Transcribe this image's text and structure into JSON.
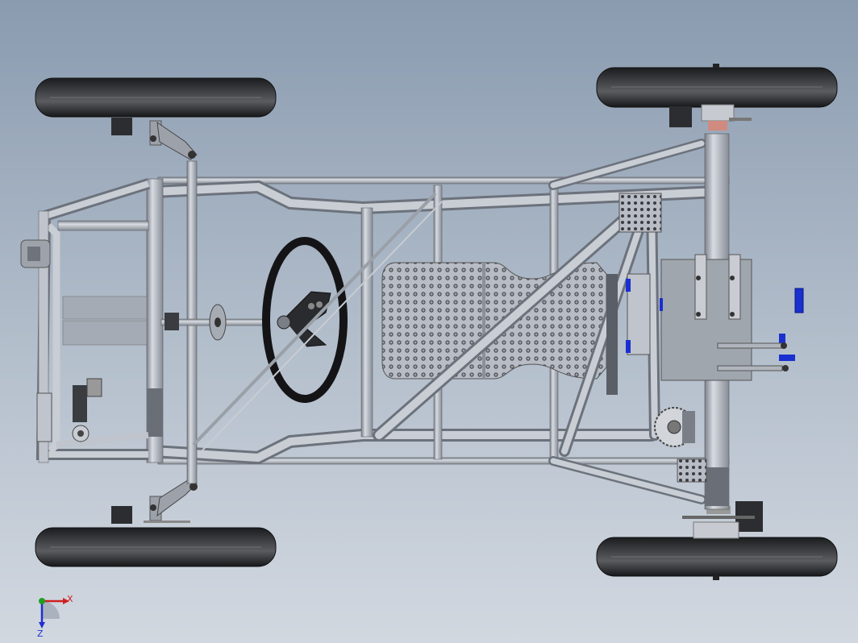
{
  "viewport": {
    "background_top": "#8a9bb0",
    "background_bottom": "#d2d8e0"
  },
  "model": {
    "tube_color": "#b9bec8",
    "tire_color": "#2a2b2e",
    "accent_blue": "#1a2fd0"
  },
  "triad": {
    "x_label": "X",
    "z_label": "Z",
    "x_color": "#d02020",
    "y_color": "#20a020",
    "z_color": "#2030d0"
  }
}
